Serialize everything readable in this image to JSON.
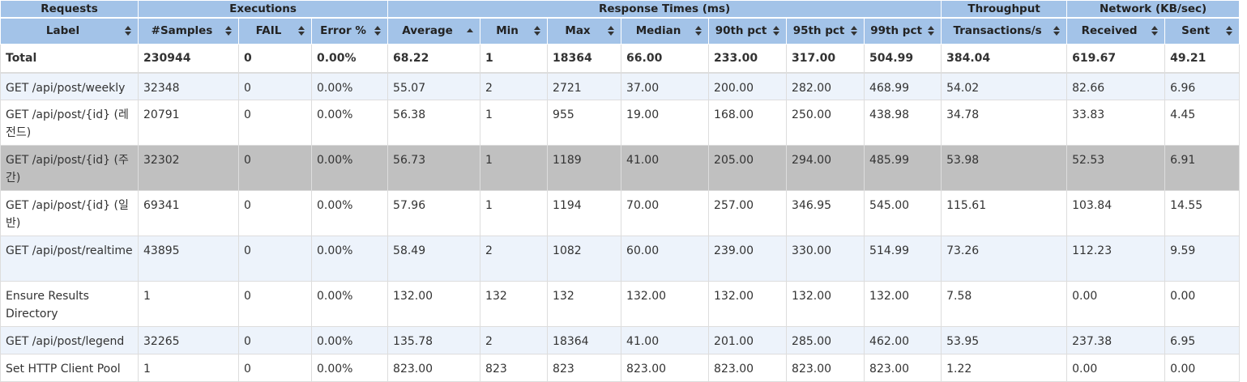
{
  "groups": [
    {
      "label": "Requests"
    },
    {
      "label": "Executions"
    },
    {
      "label": "Response Times (ms)"
    },
    {
      "label": "Throughput"
    },
    {
      "label": "Network (KB/sec)"
    }
  ],
  "columns": [
    "Label",
    "#Samples",
    "FAIL",
    "Error %",
    "Average",
    "Min",
    "Max",
    "Median",
    "90th pct",
    "95th pct",
    "99th pct",
    "Transactions/s",
    "Received",
    "Sent"
  ],
  "sorted_column": "Average",
  "sort_direction": "ascending",
  "total": [
    "Total",
    "230944",
    "0",
    "0.00%",
    "68.22",
    "1",
    "18364",
    "66.00",
    "233.00",
    "317.00",
    "504.99",
    "384.04",
    "619.67",
    "49.21"
  ],
  "rows": [
    [
      "GET /api/post/weekly",
      "32348",
      "0",
      "0.00%",
      "55.07",
      "2",
      "2721",
      "37.00",
      "200.00",
      "282.00",
      "468.99",
      "54.02",
      "82.66",
      "6.96"
    ],
    [
      "GET /api/post/{id} (레전드)",
      "20791",
      "0",
      "0.00%",
      "56.38",
      "1",
      "955",
      "19.00",
      "168.00",
      "250.00",
      "438.98",
      "34.78",
      "33.83",
      "4.45"
    ],
    [
      "GET /api/post/{id} (주간)",
      "32302",
      "0",
      "0.00%",
      "56.73",
      "1",
      "1189",
      "41.00",
      "205.00",
      "294.00",
      "485.99",
      "53.98",
      "52.53",
      "6.91"
    ],
    [
      "GET /api/post/{id} (일반)",
      "69341",
      "0",
      "0.00%",
      "57.96",
      "1",
      "1194",
      "70.00",
      "257.00",
      "346.95",
      "545.00",
      "115.61",
      "103.84",
      "14.55"
    ],
    [
      "GET /api/post/realtime",
      "43895",
      "0",
      "0.00%",
      "58.49",
      "2",
      "1082",
      "60.00",
      "239.00",
      "330.00",
      "514.99",
      "73.26",
      "112.23",
      "9.59"
    ],
    [
      "Ensure Results Directory",
      "1",
      "0",
      "0.00%",
      "132.00",
      "132",
      "132",
      "132.00",
      "132.00",
      "132.00",
      "132.00",
      "7.58",
      "0.00",
      "0.00"
    ],
    [
      "GET /api/post/legend",
      "32265",
      "0",
      "0.00%",
      "135.78",
      "2",
      "18364",
      "41.00",
      "201.00",
      "285.00",
      "462.00",
      "53.95",
      "237.38",
      "6.95"
    ],
    [
      "Set HTTP Client Pool",
      "1",
      "0",
      "0.00%",
      "823.00",
      "823",
      "823",
      "823.00",
      "823.00",
      "823.00",
      "823.00",
      "1.22",
      "0.00",
      "0.00"
    ]
  ],
  "selected_row": "GET /api/post/{id} (주간)",
  "colors": {
    "header_bg": "#a3c3e8",
    "alt_row_bg": "#edf3fb",
    "selected_row_bg": "#c0c0c0",
    "border": "#dddddd"
  },
  "icons": {
    "sort": "sort-both-arrows-icon",
    "sorted": "sort-ascending-icon"
  }
}
